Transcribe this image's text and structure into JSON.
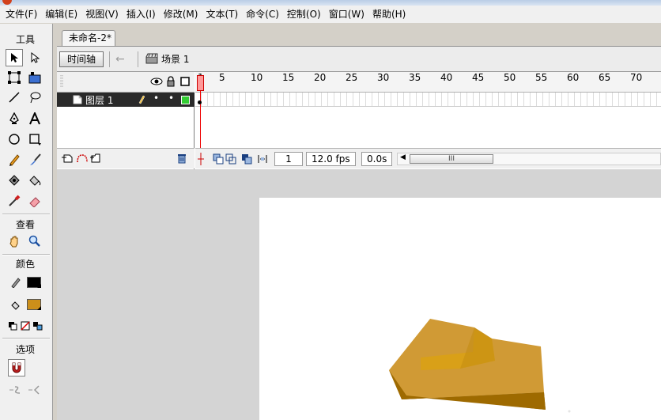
{
  "menu": [
    "文件(F)",
    "编辑(E)",
    "视图(V)",
    "插入(I)",
    "修改(M)",
    "文本(T)",
    "命令(C)",
    "控制(O)",
    "窗口(W)",
    "帮助(H)"
  ],
  "tools_panel": {
    "tools_header": "工具",
    "view_header": "查看",
    "color_header": "颜色",
    "options_header": "选项",
    "stroke_color": "#000000",
    "fill_color": "#cc8f1a"
  },
  "document": {
    "tab_title": "未命名-2*",
    "timeline_button": "时间轴",
    "scene_label": "场景 1"
  },
  "timeline": {
    "layer_name": "图层 1",
    "ruler_ticks": [
      "1",
      "5",
      "10",
      "15",
      "20",
      "25",
      "30",
      "35",
      "40",
      "45",
      "50",
      "55",
      "60",
      "65",
      "70"
    ],
    "current_frame": "1",
    "fps": "12.0 fps",
    "elapsed": "0.0s",
    "scroll_thumb": "III"
  },
  "colors": {
    "rock_top": "#d09a35",
    "rock_inner": "#d9a018",
    "rock_side": "#9e6a00",
    "layer_color": "#33cc33"
  }
}
